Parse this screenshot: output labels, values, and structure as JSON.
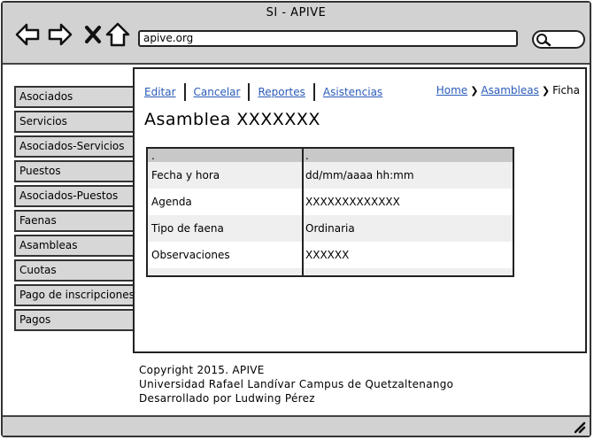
{
  "window": {
    "title": "SI - APIVE"
  },
  "toolbar": {
    "back_icon": "arrow-left-icon",
    "forward_icon": "arrow-right-icon",
    "stop_icon": "close-icon",
    "home_icon": "home-icon",
    "url": "apive.org",
    "search_icon": "search-icon"
  },
  "sidebar": {
    "items": [
      {
        "label": "Asociados"
      },
      {
        "label": "Servicios"
      },
      {
        "label": "Asociados-Servicios"
      },
      {
        "label": "Puestos"
      },
      {
        "label": "Asociados-Puestos"
      },
      {
        "label": "Faenas"
      },
      {
        "label": "Asambleas"
      },
      {
        "label": "Cuotas"
      },
      {
        "label": "Pago de inscripciones"
      },
      {
        "label": "Pagos"
      }
    ]
  },
  "main": {
    "actions": [
      "Editar",
      "Cancelar",
      "Reportes",
      "Asistencias"
    ],
    "breadcrumb": [
      "Home",
      "Asambleas",
      "Ficha"
    ],
    "title": "Asamblea XXXXXXX",
    "table": {
      "header": [
        ".",
        "."
      ],
      "rows": [
        {
          "label": "Fecha y hora",
          "value": "dd/mm/aaaa hh:mm"
        },
        {
          "label": "Agenda",
          "value": "XXXXXXXXXXXXX"
        },
        {
          "label": "Tipo de faena",
          "value": "Ordinaria"
        },
        {
          "label": "Observaciones",
          "value": "XXXXXX"
        }
      ]
    }
  },
  "footer": {
    "line1": "Copyright 2015.  APIVE",
    "line2": "Universidad Rafael Landívar Campus de Quetzaltenango",
    "line3": "Desarrollado por Ludwing Pérez"
  },
  "colors": {
    "link": "#2a5bb8",
    "chrome": "#d2d2d2",
    "sidebar": "#d7d7d7",
    "row_shade": "#efefef",
    "header": "#c8c8c8"
  }
}
